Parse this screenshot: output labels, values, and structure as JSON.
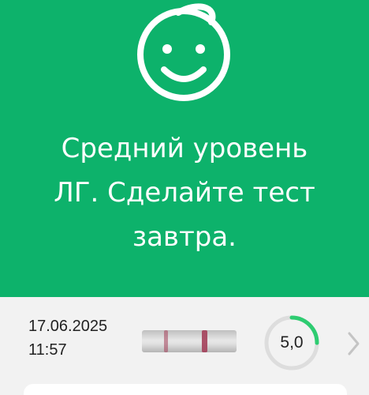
{
  "hero": {
    "icon": "baby-face-icon",
    "background_color": "#0db26b",
    "message_lines": [
      "Средний уровень",
      "ЛГ. Сделайте тест",
      "завтра."
    ]
  },
  "result": {
    "date": "17.06.2025",
    "time": "11:57",
    "value": "5,0",
    "gauge_fraction": 0.25,
    "gauge_color": "#2ecc71",
    "strip_line_color": "#a4405a",
    "chevron_icon": "chevron-right-icon"
  }
}
